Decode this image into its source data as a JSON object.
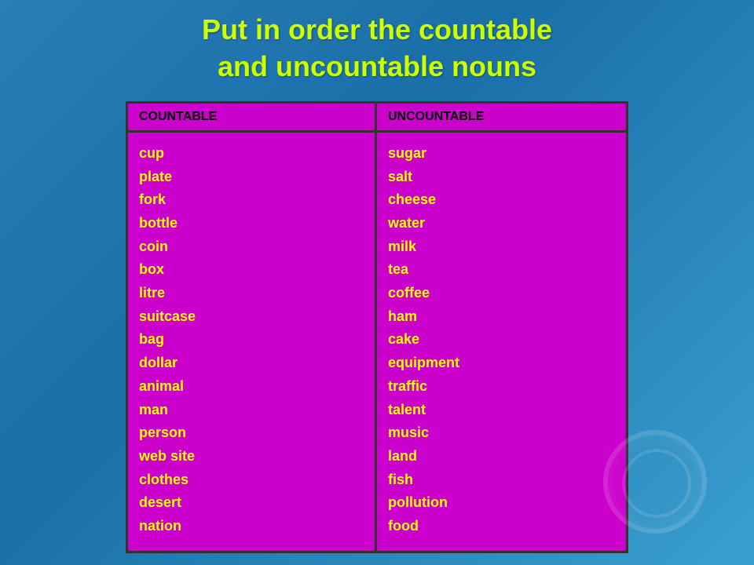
{
  "title": {
    "line1": "Put in order the countable",
    "line2": "and uncountable nouns"
  },
  "table": {
    "headers": {
      "col1": "COUNTABLE",
      "col2": "UNCOUNTABLE"
    },
    "countable": [
      "cup",
      "plate",
      "fork",
      "bottle",
      "coin",
      "box",
      "litre",
      "suitcase",
      "bag",
      "dollar",
      "animal",
      "man",
      "person",
      "web site",
      "clothes",
      "desert",
      "nation"
    ],
    "uncountable": [
      "sugar",
      "salt",
      "cheese",
      "water",
      "milk",
      "tea",
      "coffee",
      "ham",
      "cake",
      "equipment",
      "traffic",
      "talent",
      "music",
      "land",
      "fish",
      "pollution",
      "food"
    ]
  }
}
